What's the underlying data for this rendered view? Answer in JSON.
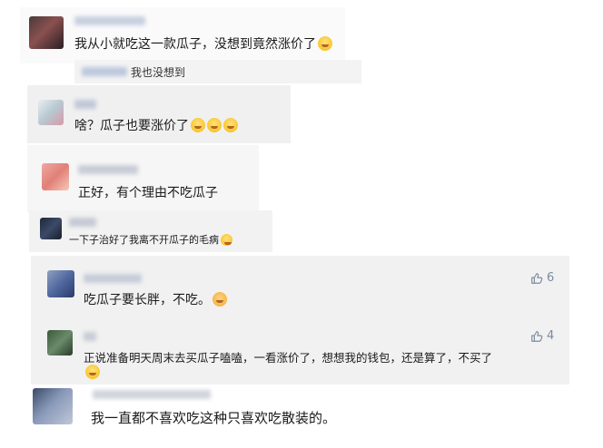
{
  "comments": [
    {
      "text": "我从小就吃这一款瓜子，没想到竟然涨价了",
      "emoji": "laugh-cry-emoji"
    },
    {
      "reply_text": "我也没想到"
    },
    {
      "text": "啥？瓜子也要涨价了",
      "emoji": "laugh-cry-emoji"
    },
    {
      "text": "正好，有个理由不吃瓜子"
    },
    {
      "text": "一下子治好了我离不开瓜子的毛病",
      "emoji": "smile-emoji"
    },
    {
      "text": "吃瓜子要长胖，不吃。",
      "emoji": "cat-emoji",
      "likes": "6"
    },
    {
      "text": "正说准备明天周末去买瓜子嗑嗑，一看涨价了，想想我的钱包，还是算了，不买了",
      "emoji": "laugh-cry-emoji",
      "likes": "4"
    },
    {
      "text": "我一直都不喜欢吃这种只喜欢吃散装的。"
    }
  ],
  "colors": {
    "panel_gray": "#f4f4f4",
    "panel_light": "#f6f6f6",
    "like_blue": "#7a8aa0"
  }
}
